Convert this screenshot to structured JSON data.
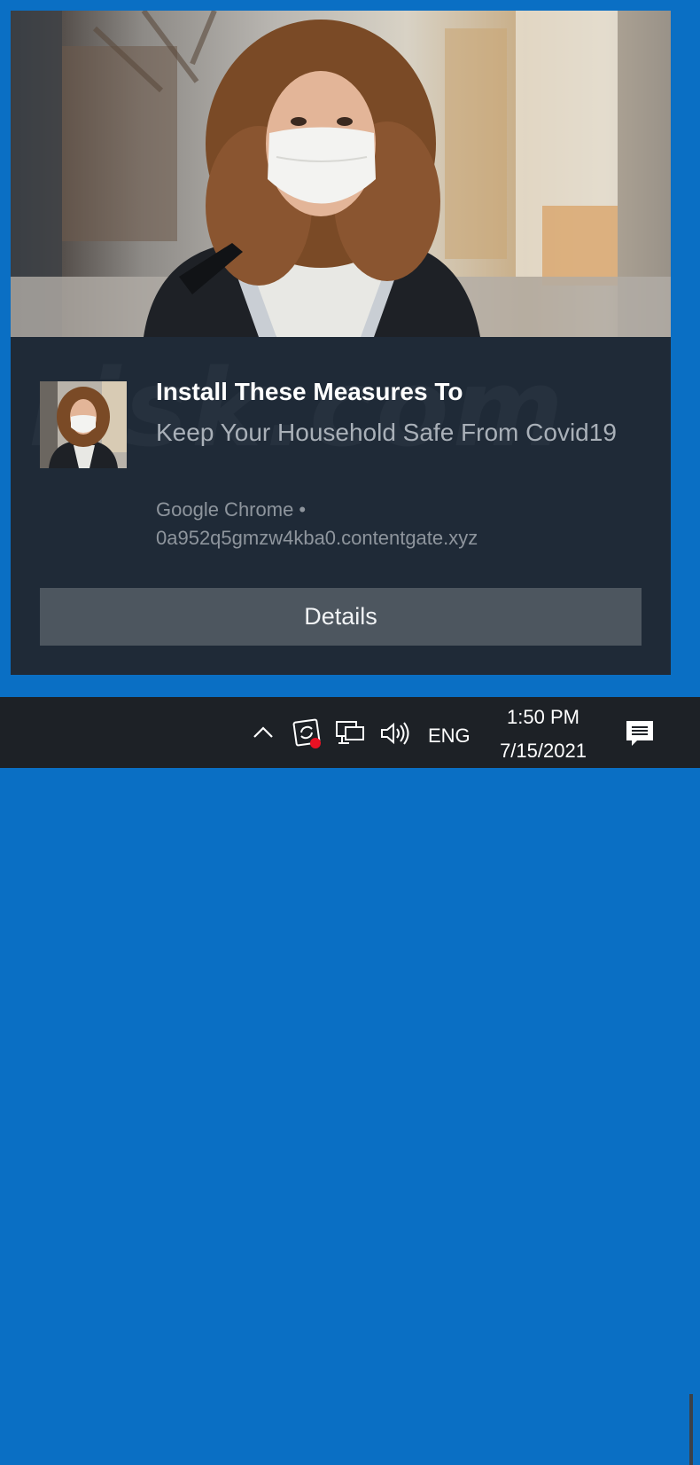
{
  "notification": {
    "hero_image": "woman-wearing-face-mask-photo",
    "thumbnail_image": "woman-wearing-face-mask-thumbnail",
    "title": "Install These Measures To",
    "body": "Keep Your Household Safe From Covid19",
    "source_app": "Google Chrome •",
    "source_url": "0a952q5gmzw4kba0.contentgate.xyz",
    "details_label": "Details",
    "watermark": "risk.com"
  },
  "taskbar": {
    "icons": [
      "chevron-up-icon",
      "sync-alert-icon",
      "network-icon",
      "volume-icon",
      "action-center-icon"
    ],
    "language": "ENG",
    "time": "1:50 PM",
    "date": "7/15/2021"
  },
  "colors": {
    "desktop_accent": "#0a6fc4",
    "toast_background": "#1f2a37",
    "button_background": "#4d565f",
    "taskbar_background": "#1d2126",
    "alert_dot": "#e81123"
  }
}
